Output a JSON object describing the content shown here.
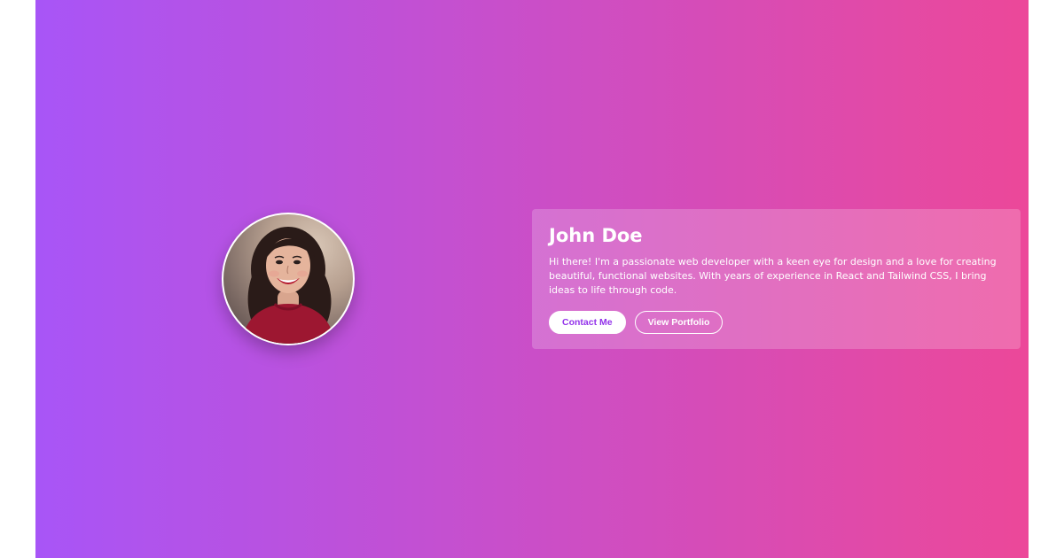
{
  "profile": {
    "name": "John Doe",
    "bio": "Hi there! I'm a passionate web developer with a keen eye for design and a love for creating beautiful, functional websites. With years of experience in React and Tailwind CSS, I bring ideas to life through code.",
    "avatar_icon": "profile-photo"
  },
  "actions": {
    "contact_label": "Contact Me",
    "portfolio_label": "View Portfolio"
  },
  "theme": {
    "gradient_start": "#a855f7",
    "gradient_end": "#ec4899",
    "primary_button_text": "#9333ea"
  }
}
